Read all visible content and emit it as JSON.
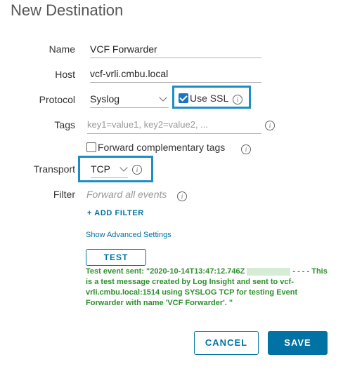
{
  "dialog": {
    "title": "New Destination"
  },
  "form": {
    "name_label": "Name",
    "name_value": "VCF Forwarder",
    "host_label": "Host",
    "host_value": "vcf-vrli.cmbu.local",
    "protocol_label": "Protocol",
    "protocol_value": "Syslog",
    "use_ssl_label": "Use SSL",
    "use_ssl_checked": true,
    "tags_label": "Tags",
    "tags_placeholder": "key1=value1, key2=value2, ...",
    "forward_tags_label": "Forward complementary tags",
    "forward_tags_checked": false,
    "transport_label": "Transport",
    "transport_value": "TCP",
    "filter_label": "Filter",
    "filter_placeholder": "Forward all events",
    "add_filter_label": "+ ADD FILTER",
    "advanced_link": "Show Advanced Settings",
    "test_button": "TEST",
    "test_result_prefix": "Test event sent: \"2020-10-14T13:47:12.746Z",
    "test_result_suffix": "- - - - This is a test message created by Log Insight and sent to vcf-vrli.cmbu.local:1514 using SYSLOG TCP for testing Event Forwarder with name 'VCF Forwarder'. \""
  },
  "footer": {
    "cancel_label": "CANCEL",
    "save_label": "SAVE"
  },
  "icons": {
    "info": "info-icon",
    "dropdown": "chevron-down-icon",
    "checkbox": "checkbox-icon"
  },
  "colors": {
    "accent": "#0072a3",
    "highlight": "#1e8dc6",
    "success": "#2c8f2c"
  }
}
